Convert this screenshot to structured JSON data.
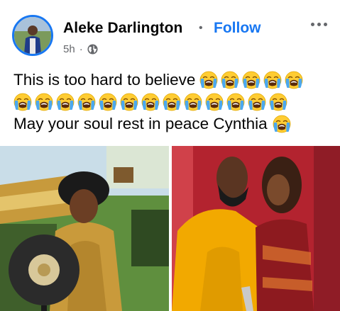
{
  "post": {
    "author": "Aleke Darlington",
    "separator": "•",
    "follow_label": "Follow",
    "time": "5h",
    "meta_sep": "·",
    "privacy_icon": "globe-icon",
    "more_icon": "more-options-icon",
    "text_lines": [
      "This is too hard to believe",
      "",
      "May your soul rest in peace Cynthia"
    ],
    "emoji": "loudly-crying-face",
    "emoji_counts": [
      5,
      13,
      1
    ]
  },
  "colors": {
    "accent": "#1877f2",
    "meta_text": "#65676b",
    "body_text": "#050505"
  }
}
